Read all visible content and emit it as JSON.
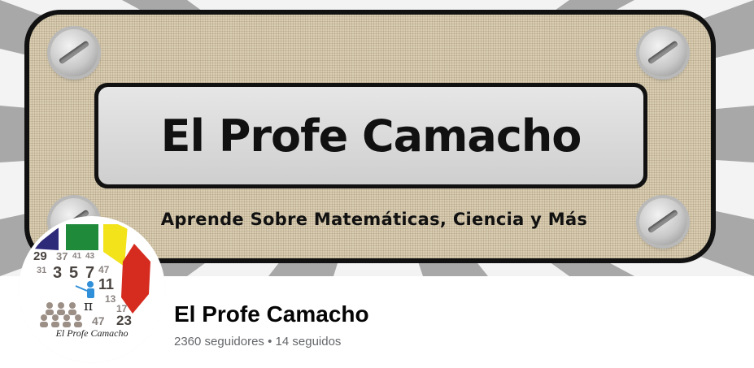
{
  "cover": {
    "title": "El Profe Camacho",
    "tagline": "Aprende Sobre Matemáticas, Ciencia y Más"
  },
  "avatar": {
    "caption": "El Profe Camacho",
    "numbers": [
      "29",
      "37",
      "41",
      "43",
      "31",
      "3",
      "5",
      "7",
      "47",
      "11",
      "13",
      "17",
      "47",
      "23"
    ],
    "pi_symbol": "π"
  },
  "profile": {
    "name": "El Profe Camacho",
    "followers": "2360 seguidores",
    "separator": "•",
    "following": "14 seguidos"
  }
}
